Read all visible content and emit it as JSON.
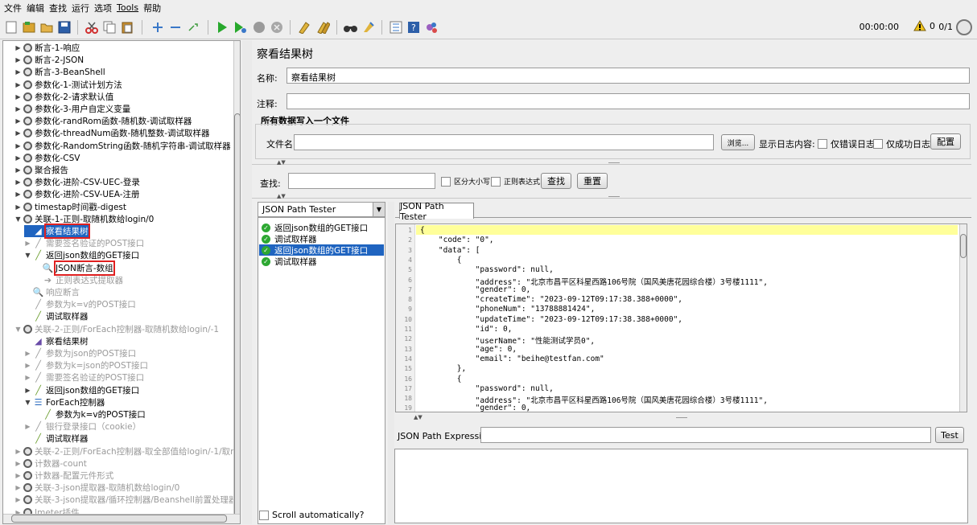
{
  "menu": [
    "文件",
    "编辑",
    "查找",
    "运行",
    "选项",
    "Tools",
    "帮助"
  ],
  "toolbar": {
    "time": "00:00:00",
    "warnings": "0",
    "threads": "0/1"
  },
  "tree": [
    {
      "label": "断言-1-响应",
      "icon": "tg",
      "indent": 0,
      "tw": "▶",
      "dis": false,
      "sel": false,
      "red": false
    },
    {
      "label": "断言-2-JSON",
      "icon": "tg",
      "indent": 0,
      "tw": "▶",
      "dis": false,
      "sel": false,
      "red": false
    },
    {
      "label": "断言-3-BeanShell",
      "icon": "tg",
      "indent": 0,
      "tw": "▶",
      "dis": false,
      "sel": false,
      "red": false
    },
    {
      "label": "参数化-1-测试计划方法",
      "icon": "tg",
      "indent": 0,
      "tw": "▶",
      "dis": false,
      "sel": false,
      "red": false
    },
    {
      "label": "参数化-2-请求默认值",
      "icon": "tg",
      "indent": 0,
      "tw": "▶",
      "dis": false,
      "sel": false,
      "red": false
    },
    {
      "label": "参数化-3-用户自定义变量",
      "icon": "tg",
      "indent": 0,
      "tw": "▶",
      "dis": false,
      "sel": false,
      "red": false
    },
    {
      "label": "参数化-randRom函数-随机数-调试取样器",
      "icon": "tg",
      "indent": 0,
      "tw": "▶",
      "dis": false,
      "sel": false,
      "red": false
    },
    {
      "label": "参数化-threadNum函数-随机整数-调试取样器",
      "icon": "tg",
      "indent": 0,
      "tw": "▶",
      "dis": false,
      "sel": false,
      "red": false
    },
    {
      "label": "参数化-RandomString函数-随机字符串-调试取样器",
      "icon": "tg",
      "indent": 0,
      "tw": "▶",
      "dis": false,
      "sel": false,
      "red": false
    },
    {
      "label": "参数化-CSV",
      "icon": "tg",
      "indent": 0,
      "tw": "▶",
      "dis": false,
      "sel": false,
      "red": false
    },
    {
      "label": "聚合报告",
      "icon": "tg",
      "indent": 0,
      "tw": "▶",
      "dis": false,
      "sel": false,
      "red": false
    },
    {
      "label": "参数化-进阶-CSV-UEC-登录",
      "icon": "tg",
      "indent": 0,
      "tw": "▶",
      "dis": false,
      "sel": false,
      "red": false
    },
    {
      "label": "参数化-进阶-CSV-UEA-注册",
      "icon": "tg",
      "indent": 0,
      "tw": "▶",
      "dis": false,
      "sel": false,
      "red": false
    },
    {
      "label": "timestap时间戳-digest",
      "icon": "tg",
      "indent": 0,
      "tw": "▶",
      "dis": false,
      "sel": false,
      "red": false
    },
    {
      "label": "关联-1-正则-取随机数给login/0",
      "icon": "tg",
      "indent": 0,
      "tw": "▼",
      "dis": false,
      "sel": false,
      "red": false
    },
    {
      "label": "察看结果树",
      "icon": "ls",
      "indent": 1,
      "tw": "",
      "dis": false,
      "sel": true,
      "red": true
    },
    {
      "label": "需要签名验证的POST接口",
      "icon": "sm",
      "indent": 1,
      "tw": "▶",
      "dis": true,
      "sel": false,
      "red": false
    },
    {
      "label": "返回json数组的GET接口",
      "icon": "sm",
      "indent": 1,
      "tw": "▼",
      "dis": false,
      "sel": false,
      "red": false
    },
    {
      "label": "JSON断言-数组",
      "icon": "as",
      "indent": 2,
      "tw": "",
      "dis": false,
      "sel": false,
      "red": true
    },
    {
      "label": "正则表达式提取器",
      "icon": "pp",
      "indent": 2,
      "tw": "",
      "dis": true,
      "sel": false,
      "red": false
    },
    {
      "label": "响应断言",
      "icon": "as",
      "indent": 1,
      "tw": "",
      "dis": true,
      "sel": false,
      "red": false
    },
    {
      "label": "参数为k=v的POST接口",
      "icon": "sm",
      "indent": 1,
      "tw": "",
      "dis": true,
      "sel": false,
      "red": false
    },
    {
      "label": "调试取样器",
      "icon": "sm",
      "indent": 1,
      "tw": "",
      "dis": false,
      "sel": false,
      "red": false
    },
    {
      "label": "关联-2-正则/ForEach控制器-取随机数给login/-1",
      "icon": "tg",
      "indent": 0,
      "tw": "▼",
      "dis": true,
      "sel": false,
      "red": false
    },
    {
      "label": "察看结果树",
      "icon": "ls",
      "indent": 1,
      "tw": "",
      "dis": false,
      "sel": false,
      "red": false
    },
    {
      "label": "参数为json的POST接口",
      "icon": "sm",
      "indent": 1,
      "tw": "▶",
      "dis": true,
      "sel": false,
      "red": false
    },
    {
      "label": "参数为k=json的POST接口",
      "icon": "sm",
      "indent": 1,
      "tw": "▶",
      "dis": true,
      "sel": false,
      "red": false
    },
    {
      "label": "需要签名验证的POST接口",
      "icon": "sm",
      "indent": 1,
      "tw": "▶",
      "dis": true,
      "sel": false,
      "red": false
    },
    {
      "label": "返回json数组的GET接口",
      "icon": "sm",
      "indent": 1,
      "tw": "▶",
      "dis": false,
      "sel": false,
      "red": false
    },
    {
      "label": "ForEach控制器",
      "icon": "fe",
      "indent": 1,
      "tw": "▼",
      "dis": false,
      "sel": false,
      "red": false
    },
    {
      "label": "参数为k=v的POST接口",
      "icon": "sm",
      "indent": 2,
      "tw": "",
      "dis": false,
      "sel": false,
      "red": false
    },
    {
      "label": "银行登录接口（cookie）",
      "icon": "sm",
      "indent": 1,
      "tw": "▶",
      "dis": true,
      "sel": false,
      "red": false
    },
    {
      "label": "调试取样器",
      "icon": "sm",
      "indent": 1,
      "tw": "",
      "dis": false,
      "sel": false,
      "red": false
    },
    {
      "label": "关联-2-正则/ForEach控制器-取全部值给login/-1/取match",
      "icon": "tg",
      "indent": 0,
      "tw": "▶",
      "dis": true,
      "sel": false,
      "red": false
    },
    {
      "label": "计数器-count",
      "icon": "tg",
      "indent": 0,
      "tw": "▶",
      "dis": true,
      "sel": false,
      "red": false
    },
    {
      "label": "计数器-配置元件形式",
      "icon": "tg",
      "indent": 0,
      "tw": "▶",
      "dis": true,
      "sel": false,
      "red": false
    },
    {
      "label": "关联-3-json提取器-取随机数给login/0",
      "icon": "tg",
      "indent": 0,
      "tw": "▶",
      "dis": true,
      "sel": false,
      "red": false
    },
    {
      "label": "关联-3-json提取器/循环控制器/Beanshell前置处理器-取全",
      "icon": "tg",
      "indent": 0,
      "tw": "▶",
      "dis": true,
      "sel": false,
      "red": false
    },
    {
      "label": "Jmeter插件",
      "icon": "tg",
      "indent": 0,
      "tw": "▶",
      "dis": true,
      "sel": false,
      "red": false
    }
  ],
  "panel": {
    "title": "察看结果树",
    "name_label": "名称:",
    "name_value": "察看结果树",
    "comment_label": "注释:",
    "comment_value": "",
    "file_section": "所有数据写入一个文件",
    "file_label": "文件名",
    "file_value": "",
    "browse": "浏览...",
    "log_label": "显示日志内容:",
    "errors_only": "仅错误日志",
    "success_only": "仅成功日志",
    "configure": "配置",
    "search_label": "查找:",
    "search_value": "",
    "case_sensitive": "区分大小写",
    "regex": "正则表达式",
    "search_btn": "查找",
    "reset_btn": "重置"
  },
  "results": {
    "renderer": "JSON Path Tester",
    "samples": [
      "返回json数组的GET接口",
      "调试取样器",
      "返回json数组的GET接口",
      "调试取样器"
    ],
    "selected_index": 2,
    "scroll_auto": "Scroll automatically?",
    "tab": "JSON Path Tester",
    "code_lines": [
      "{",
      "    \"code\": \"0\",",
      "    \"data\": [",
      "        {",
      "            \"password\": null,",
      "            \"address\": \"北京市昌平区科星西路106号院（国风美唐花园综合楼）3号楼1111\",",
      "            \"gender\": 0,",
      "            \"createTime\": \"2023-09-12T09:17:38.388+0000\",",
      "            \"phoneNum\": \"13788881424\",",
      "            \"updateTime\": \"2023-09-12T09:17:38.388+0000\",",
      "            \"id\": 0,",
      "            \"userName\": \"性能测试学员0\",",
      "            \"age\": 0,",
      "            \"email\": \"beihe@testfan.com\"",
      "        },",
      "        {",
      "            \"password\": null,",
      "            \"address\": \"北京市昌平区科星西路106号院（国风美唐花园综合楼）3号楼1111\",",
      "            \"gender\": 0,"
    ],
    "jsonpath_label": "JSON Path Expression",
    "jsonpath_value": "",
    "test_btn": "Test"
  }
}
